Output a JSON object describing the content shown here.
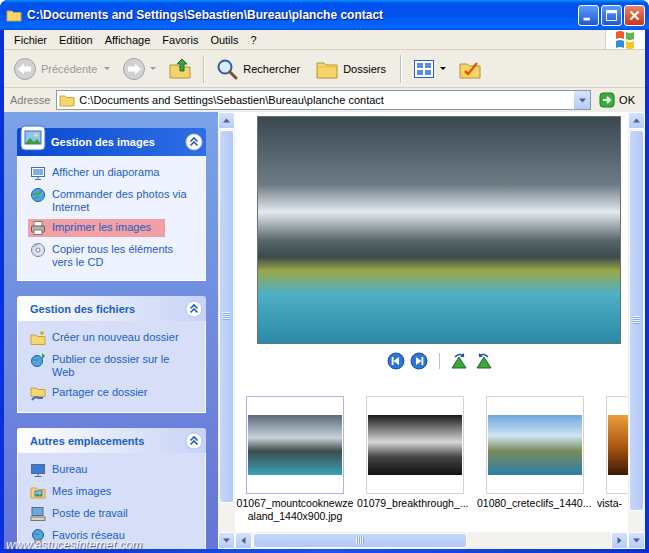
{
  "window": {
    "title": "C:\\Documents and Settings\\Sebastien\\Bureau\\planche contact"
  },
  "menu": [
    "Fichier",
    "Edition",
    "Affichage",
    "Favoris",
    "Outils",
    "?"
  ],
  "toolbar": [
    {
      "kind": "back",
      "label": "Précédente",
      "disabled": true,
      "dropdown": true
    },
    {
      "kind": "forward",
      "disabled": true,
      "dropdown": true
    },
    {
      "kind": "up",
      "disabled": false,
      "dropdown": false
    },
    {
      "kind": "search",
      "label": "Rechercher",
      "disabled": false,
      "dropdown": false
    },
    {
      "kind": "folders",
      "label": "Dossiers",
      "disabled": false,
      "dropdown": false
    },
    {
      "kind": "views",
      "disabled": false,
      "dropdown": true
    },
    {
      "kind": "sync",
      "disabled": false,
      "dropdown": false
    }
  ],
  "address": {
    "label": "Adresse",
    "value": "C:\\Documents and Settings\\Sebastien\\Bureau\\planche contact",
    "go": "OK"
  },
  "sidebar": [
    {
      "title": "Gestion des images",
      "special": true,
      "expanded": true,
      "items": [
        {
          "kind": "slideshow",
          "label": "Afficher un diaporama",
          "highlighted": false
        },
        {
          "kind": "order",
          "label": "Commander des photos via Internet",
          "highlighted": false
        },
        {
          "kind": "print",
          "label": "Imprimer les images",
          "highlighted": true
        },
        {
          "kind": "cd",
          "label": "Copier tous les éléments vers le CD",
          "highlighted": false
        }
      ]
    },
    {
      "title": "Gestion des fichiers",
      "special": false,
      "expanded": true,
      "items": [
        {
          "kind": "newfolder",
          "label": "Créer un nouveau dossier",
          "highlighted": false
        },
        {
          "kind": "publish",
          "label": "Publier ce dossier sur le Web",
          "highlighted": false
        },
        {
          "kind": "share",
          "label": "Partager ce dossier",
          "highlighted": false
        }
      ]
    },
    {
      "title": "Autres emplacements",
      "special": false,
      "expanded": true,
      "items": [
        {
          "kind": "desktop",
          "label": "Bureau",
          "highlighted": false
        },
        {
          "kind": "pictures",
          "label": "Mes images",
          "highlighted": false
        },
        {
          "kind": "computer",
          "label": "Poste de travail",
          "highlighted": false
        },
        {
          "kind": "network",
          "label": "Favoris réseau",
          "highlighted": false
        }
      ]
    }
  ],
  "filmstrip": [
    {
      "caption": "01067_mountcooknewzealand_1440x900.jpg",
      "selected": true
    },
    {
      "caption": "01079_breakthrough_...",
      "selected": false
    },
    {
      "caption": "01080_creteclifs_1440...",
      "selected": false
    },
    {
      "caption": "vista-",
      "selected": false
    }
  ],
  "scrollbars": {
    "sidebar": {
      "level": 0.93
    },
    "content": {
      "level": 0.95
    },
    "filmstrip": {
      "level": 0.6
    }
  },
  "watermark": "www.astucesinternet.com"
}
